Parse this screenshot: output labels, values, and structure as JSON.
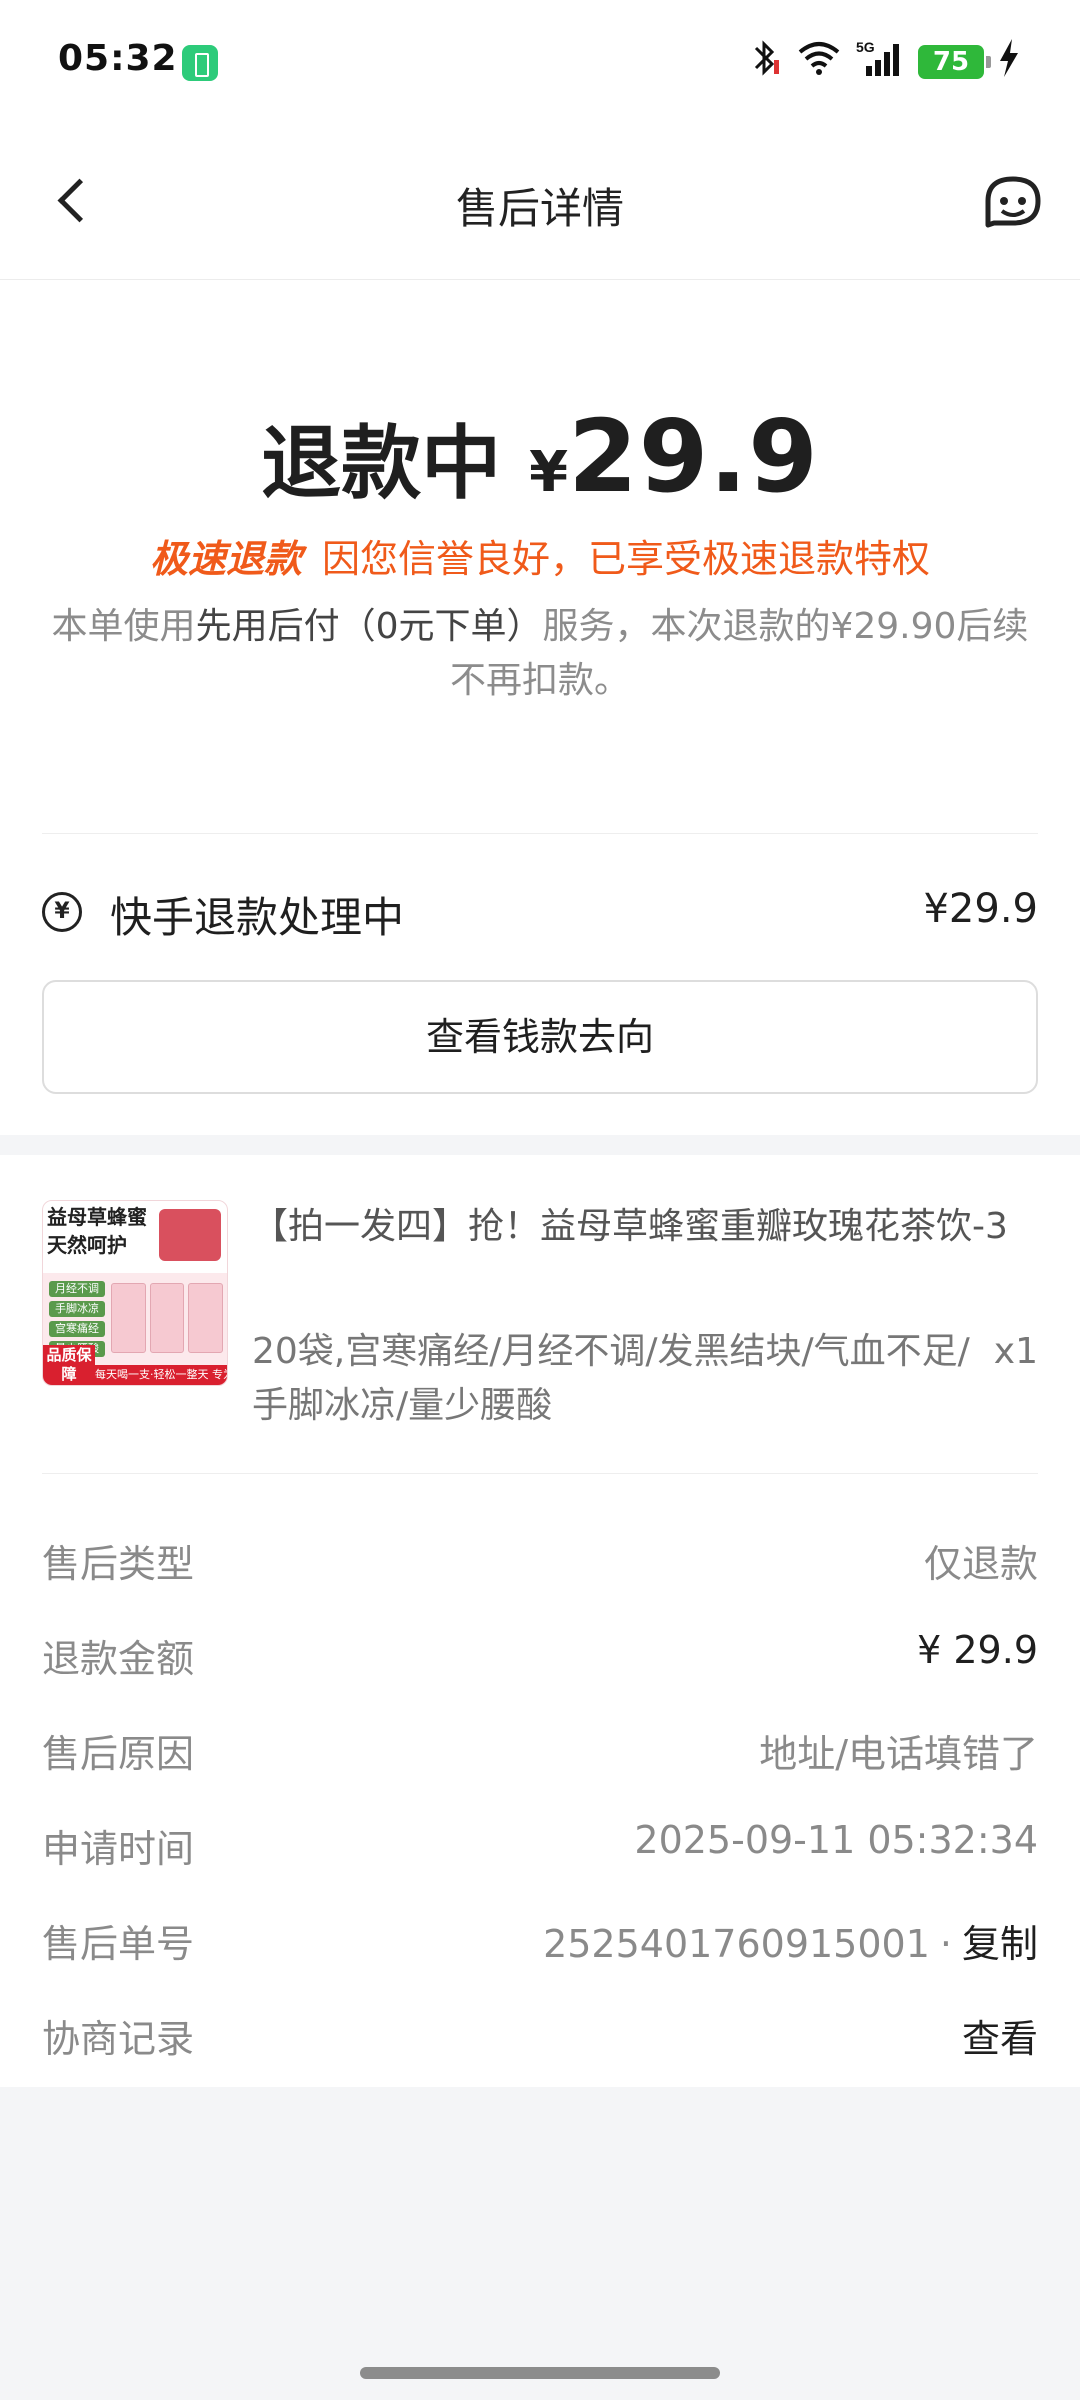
{
  "status_bar": {
    "time": "05:32",
    "network": "5G",
    "battery_level": "75"
  },
  "nav": {
    "title": "售后详情",
    "back_icon": "chevron-left-icon",
    "service_icon": "customer-service-icon"
  },
  "summary": {
    "status_text": "退款中",
    "currency": "¥",
    "amount": "29.9",
    "fast_refund_tag": "极速退款",
    "fast_refund_text": "因您信誉良好，已享受极速退款特权",
    "desc_prefix": "本单使用",
    "desc_highlight": "先用后付（0元下单）",
    "desc_suffix": "服务，本次退款的¥29.90后续不再扣款。",
    "progress_label": "快手退款处理中",
    "progress_amount": "¥29.9",
    "track_button": "查看钱款去向"
  },
  "product": {
    "title": "【拍一发四】抢！益母草蜂蜜重瓣玫瑰花茶饮-3",
    "spec": "20袋,宫寒痛经/月经不调/发黑结块/气血不足/手脚冰凉/量少腰酸",
    "quantity": "x1",
    "thumb": {
      "headline1": "益母草蜂蜜",
      "headline2": "天然呵护",
      "tags": [
        "月经不调",
        "手脚冰凉",
        "宫寒痛经",
        "量少腰酸"
      ],
      "badge": "品质保障",
      "footer": "每天喝一支·轻松一整天 专为女性健康问题研发"
    }
  },
  "info": {
    "type_label": "售后类型",
    "type_value": "仅退款",
    "amount_label": "退款金额",
    "amount_value": "¥ 29.9",
    "reason_label": "售后原因",
    "reason_value": "地址/电话填错了",
    "time_label": "申请时间",
    "time_value": "2025-09-11 05:32:34",
    "order_label": "售后单号",
    "order_value": "2525401760915001",
    "copy_label": "复制",
    "record_label": "协商记录",
    "record_value": "查看"
  },
  "colors": {
    "accent_orange": "#F05A1A",
    "battery_green": "#2FB83A"
  }
}
